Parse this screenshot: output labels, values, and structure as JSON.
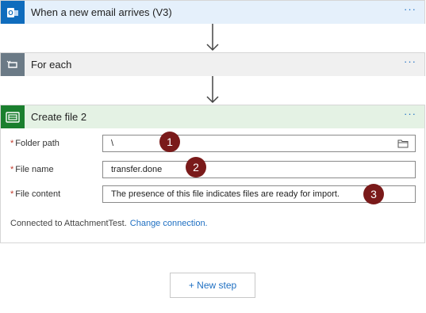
{
  "trigger": {
    "title": "When a new email arrives (V3)",
    "menu": "···"
  },
  "foreach": {
    "title": "For each",
    "menu": "···"
  },
  "create_file": {
    "title": "Create file 2",
    "menu": "···",
    "required_mark": "*",
    "fields": [
      {
        "label": "Folder path",
        "value": "\\",
        "badge": "1"
      },
      {
        "label": "File name",
        "value": "transfer.done",
        "badge": "2"
      },
      {
        "label": "File content",
        "value": "The presence of this file indicates files are ready for import.",
        "badge": "3"
      }
    ],
    "connected_text": "Connected to AttachmentTest.",
    "change_connection": "Change connection."
  },
  "new_step": {
    "label": "+ New step"
  },
  "colors": {
    "trigger_icon_bg": "#0f6cbd",
    "foreach_icon_bg": "#6b7a86",
    "create_icon_bg": "#1a7f2e",
    "badge": "#7a1a1a",
    "link": "#1e6fc2"
  }
}
